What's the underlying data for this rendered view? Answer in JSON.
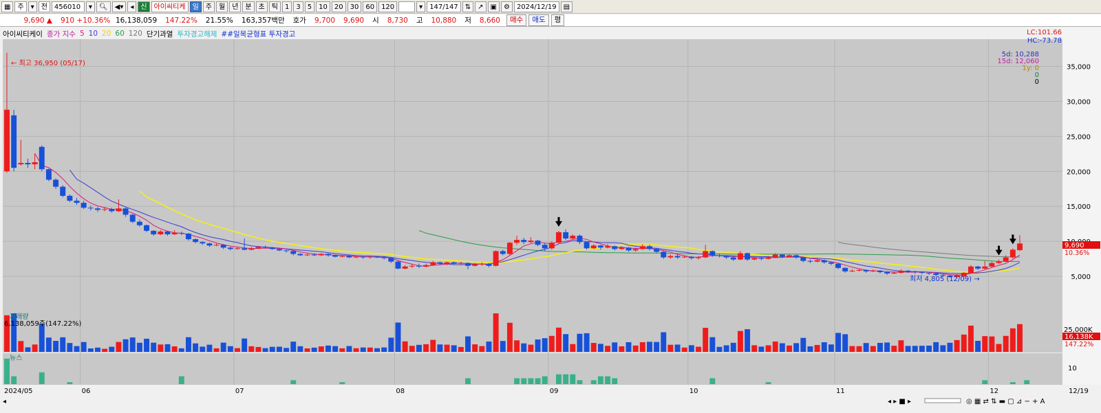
{
  "toolbar": {
    "code": "456010",
    "mode": "주",
    "market": "전",
    "badge": "신",
    "name": "아이씨티케",
    "periods": [
      "일",
      "주",
      "월",
      "년",
      "분",
      "초",
      "틱"
    ],
    "ticks": [
      "1",
      "3",
      "5",
      "10",
      "20",
      "30",
      "60",
      "120"
    ],
    "count": "147/147",
    "date": "2024/12/19"
  },
  "quote": {
    "price": "9,690",
    "change": "910",
    "change_pct": "+10.36%",
    "volume": "16,138,059",
    "vol_pct": "147.22%",
    "turnover": "21.55%",
    "amount": "163,357백만",
    "ask_label": "호가",
    "ask1": "9,700",
    "ask2": "9,690",
    "open_label": "시",
    "open": "8,730",
    "high_label": "고",
    "high": "10,880",
    "low_label": "저",
    "low": "8,660",
    "buy": "매수",
    "sell": "매도",
    "flat": "평"
  },
  "legend": {
    "name": "아이씨티케이",
    "ma_label": "종가 지수",
    "ma": [
      "5",
      "10",
      "20",
      "60",
      "120"
    ],
    "warn1": "단기과열",
    "warn2": "투자경고해제",
    "warn3": "##일목균형표 투자경고"
  },
  "colors": {
    "up": "#ee1c1c",
    "down": "#1850d8",
    "ma5": "#d81a7a",
    "ma10": "#3c3cd0",
    "ma20": "#f4ef1a",
    "ma60": "#2a9a48",
    "ma120": "#7a7a7a",
    "bg": "#c8c8c8"
  },
  "corner": {
    "lc": "LC:101.66",
    "hc": "HC:-73.78"
  },
  "right_info": {
    "d5": "5d: 10,288",
    "d15": "15d: 12,060",
    "y1": "1y: 0",
    "z1": "0",
    "z2": "0"
  },
  "chart_data": {
    "type": "candlestick",
    "y_ticks": [
      "35,000",
      "30,000",
      "25,000",
      "20,000",
      "15,000",
      "10,000",
      "5,000"
    ],
    "ylim": [
      0,
      38000
    ],
    "x_labels": [
      "2024/05",
      "06",
      "07",
      "08",
      "09",
      "10",
      "11",
      "12",
      "12/19"
    ],
    "annotations": {
      "high": "최고 36,950 (05/17)",
      "low": "최저 4,805 (12/09)"
    },
    "last_price": "9,690",
    "last_pct": "10.36%",
    "candles": [
      {
        "o": 20000,
        "c": 28800,
        "h": 36950,
        "l": 19800
      },
      {
        "o": 28000,
        "c": 20500,
        "h": 28800,
        "l": 20000
      },
      {
        "o": 21000,
        "c": 21200,
        "h": 24500,
        "l": 20800
      },
      {
        "o": 21200,
        "c": 21000,
        "h": 21800,
        "l": 20500
      },
      {
        "o": 21000,
        "c": 21300,
        "h": 22500,
        "l": 20300
      },
      {
        "o": 23500,
        "c": 20300,
        "h": 23700,
        "l": 20000
      },
      {
        "o": 20300,
        "c": 18800,
        "h": 20400,
        "l": 18600
      },
      {
        "o": 18800,
        "c": 17800,
        "h": 19000,
        "l": 17500
      },
      {
        "o": 17800,
        "c": 16500,
        "h": 18000,
        "l": 16300
      },
      {
        "o": 16500,
        "c": 15800,
        "h": 16700,
        "l": 15600
      },
      {
        "o": 15800,
        "c": 15500,
        "h": 16200,
        "l": 15200
      },
      {
        "o": 15500,
        "c": 14800,
        "h": 15800,
        "l": 14600
      },
      {
        "o": 14800,
        "c": 14700,
        "h": 15100,
        "l": 14400
      },
      {
        "o": 14700,
        "c": 14500,
        "h": 14900,
        "l": 14200
      },
      {
        "o": 14500,
        "c": 14600,
        "h": 14900,
        "l": 14300
      },
      {
        "o": 14600,
        "c": 14300,
        "h": 14800,
        "l": 14100
      },
      {
        "o": 14300,
        "c": 14700,
        "h": 16000,
        "l": 14200
      },
      {
        "o": 14700,
        "c": 13800,
        "h": 14800,
        "l": 13500
      },
      {
        "o": 13800,
        "c": 12800,
        "h": 13900,
        "l": 12600
      },
      {
        "o": 12800,
        "c": 12300,
        "h": 13100,
        "l": 12100
      },
      {
        "o": 12300,
        "c": 11500,
        "h": 12400,
        "l": 11300
      },
      {
        "o": 11500,
        "c": 11000,
        "h": 11600,
        "l": 10800
      },
      {
        "o": 11000,
        "c": 11400,
        "h": 11600,
        "l": 10900
      },
      {
        "o": 11400,
        "c": 11000,
        "h": 11500,
        "l": 10800
      },
      {
        "o": 11000,
        "c": 11200,
        "h": 11600,
        "l": 10900
      },
      {
        "o": 11200,
        "c": 11100,
        "h": 11400,
        "l": 10900
      },
      {
        "o": 11100,
        "c": 10300,
        "h": 11200,
        "l": 10100
      },
      {
        "o": 10300,
        "c": 9900,
        "h": 10400,
        "l": 9700
      },
      {
        "o": 9900,
        "c": 9700,
        "h": 10000,
        "l": 9500
      },
      {
        "o": 9700,
        "c": 9400,
        "h": 9800,
        "l": 9200
      },
      {
        "o": 9400,
        "c": 9500,
        "h": 9700,
        "l": 9300
      },
      {
        "o": 9500,
        "c": 9100,
        "h": 9600,
        "l": 8900
      },
      {
        "o": 9100,
        "c": 8900,
        "h": 9200,
        "l": 8700
      },
      {
        "o": 8900,
        "c": 9000,
        "h": 9200,
        "l": 8800
      },
      {
        "o": 9000,
        "c": 8800,
        "h": 10400,
        "l": 8700
      },
      {
        "o": 8800,
        "c": 9000,
        "h": 9200,
        "l": 8700
      },
      {
        "o": 9000,
        "c": 9200,
        "h": 9300,
        "l": 8900
      },
      {
        "o": 9200,
        "c": 9100,
        "h": 9400,
        "l": 9000
      },
      {
        "o": 9100,
        "c": 8900,
        "h": 9200,
        "l": 8800
      },
      {
        "o": 8900,
        "c": 8700,
        "h": 9000,
        "l": 8600
      },
      {
        "o": 8700,
        "c": 8600,
        "h": 8800,
        "l": 8400
      },
      {
        "o": 8600,
        "c": 8200,
        "h": 8700,
        "l": 8000
      },
      {
        "o": 8200,
        "c": 8000,
        "h": 8300,
        "l": 7900
      },
      {
        "o": 8000,
        "c": 8100,
        "h": 8200,
        "l": 7900
      },
      {
        "o": 8100,
        "c": 8000,
        "h": 8300,
        "l": 7900
      },
      {
        "o": 8000,
        "c": 8200,
        "h": 8300,
        "l": 7900
      },
      {
        "o": 8200,
        "c": 8000,
        "h": 8300,
        "l": 7800
      },
      {
        "o": 8000,
        "c": 7800,
        "h": 8100,
        "l": 7700
      },
      {
        "o": 7800,
        "c": 7900,
        "h": 8000,
        "l": 7700
      },
      {
        "o": 7900,
        "c": 7700,
        "h": 8000,
        "l": 7600
      },
      {
        "o": 7700,
        "c": 7800,
        "h": 7900,
        "l": 7600
      },
      {
        "o": 7800,
        "c": 7700,
        "h": 7900,
        "l": 7500
      },
      {
        "o": 7700,
        "c": 7800,
        "h": 7900,
        "l": 7500
      },
      {
        "o": 7800,
        "c": 7700,
        "h": 7900,
        "l": 7600
      },
      {
        "o": 7700,
        "c": 7600,
        "h": 7800,
        "l": 7400
      },
      {
        "o": 7600,
        "c": 7100,
        "h": 7700,
        "l": 6900
      },
      {
        "o": 7100,
        "c": 6100,
        "h": 7200,
        "l": 6000
      },
      {
        "o": 6100,
        "c": 6400,
        "h": 6600,
        "l": 6000
      },
      {
        "o": 6400,
        "c": 6500,
        "h": 6700,
        "l": 6200
      },
      {
        "o": 6500,
        "c": 6400,
        "h": 6800,
        "l": 6200
      },
      {
        "o": 6400,
        "c": 6600,
        "h": 6800,
        "l": 6300
      },
      {
        "o": 6600,
        "c": 7000,
        "h": 7200,
        "l": 6500
      },
      {
        "o": 7000,
        "c": 6800,
        "h": 7100,
        "l": 6600
      },
      {
        "o": 6800,
        "c": 7000,
        "h": 7100,
        "l": 6600
      },
      {
        "o": 7000,
        "c": 6800,
        "h": 7100,
        "l": 6700
      },
      {
        "o": 6800,
        "c": 6900,
        "h": 7100,
        "l": 6700
      },
      {
        "o": 6900,
        "c": 6500,
        "h": 7000,
        "l": 6000
      },
      {
        "o": 6500,
        "c": 6700,
        "h": 6900,
        "l": 6400
      },
      {
        "o": 6700,
        "c": 6800,
        "h": 7000,
        "l": 6500
      },
      {
        "o": 6800,
        "c": 6500,
        "h": 6900,
        "l": 6300
      },
      {
        "o": 6500,
        "c": 8600,
        "h": 8700,
        "l": 6400
      },
      {
        "o": 8600,
        "c": 8200,
        "h": 8800,
        "l": 8000
      },
      {
        "o": 8200,
        "c": 9800,
        "h": 9900,
        "l": 8000
      },
      {
        "o": 9800,
        "c": 10200,
        "h": 10800,
        "l": 9500
      },
      {
        "o": 10200,
        "c": 9900,
        "h": 10500,
        "l": 9600
      },
      {
        "o": 9900,
        "c": 10100,
        "h": 10600,
        "l": 9700
      },
      {
        "o": 10100,
        "c": 9500,
        "h": 10200,
        "l": 9300
      },
      {
        "o": 9500,
        "c": 9000,
        "h": 9800,
        "l": 8600
      },
      {
        "o": 9000,
        "c": 9800,
        "h": 10000,
        "l": 8800
      },
      {
        "o": 9800,
        "c": 11300,
        "h": 11500,
        "l": 9600
      },
      {
        "o": 11300,
        "c": 10400,
        "h": 11700,
        "l": 10200
      },
      {
        "o": 10400,
        "c": 10800,
        "h": 11000,
        "l": 10300
      },
      {
        "o": 10800,
        "c": 9900,
        "h": 11000,
        "l": 9600
      },
      {
        "o": 9900,
        "c": 9000,
        "h": 10000,
        "l": 8800
      },
      {
        "o": 9000,
        "c": 9400,
        "h": 9600,
        "l": 8900
      },
      {
        "o": 9400,
        "c": 9100,
        "h": 9500,
        "l": 8800
      },
      {
        "o": 9100,
        "c": 9300,
        "h": 9600,
        "l": 9000
      },
      {
        "o": 9300,
        "c": 8900,
        "h": 9400,
        "l": 8700
      },
      {
        "o": 8900,
        "c": 9100,
        "h": 9300,
        "l": 8800
      },
      {
        "o": 9100,
        "c": 8700,
        "h": 9200,
        "l": 8500
      },
      {
        "o": 8700,
        "c": 8900,
        "h": 9100,
        "l": 8500
      },
      {
        "o": 8900,
        "c": 9300,
        "h": 9600,
        "l": 8800
      },
      {
        "o": 9300,
        "c": 8900,
        "h": 9500,
        "l": 8700
      },
      {
        "o": 8900,
        "c": 8500,
        "h": 9000,
        "l": 8300
      },
      {
        "o": 8500,
        "c": 7700,
        "h": 8600,
        "l": 7500
      },
      {
        "o": 7700,
        "c": 7900,
        "h": 8100,
        "l": 7500
      },
      {
        "o": 7900,
        "c": 7700,
        "h": 8100,
        "l": 7500
      },
      {
        "o": 7700,
        "c": 7800,
        "h": 8000,
        "l": 7600
      },
      {
        "o": 7800,
        "c": 7600,
        "h": 7900,
        "l": 7400
      },
      {
        "o": 7600,
        "c": 7700,
        "h": 7900,
        "l": 7400
      },
      {
        "o": 7700,
        "c": 8600,
        "h": 9500,
        "l": 7600
      },
      {
        "o": 8600,
        "c": 8000,
        "h": 8700,
        "l": 7800
      },
      {
        "o": 8000,
        "c": 7900,
        "h": 8200,
        "l": 7700
      },
      {
        "o": 7900,
        "c": 7700,
        "h": 8000,
        "l": 7500
      },
      {
        "o": 7700,
        "c": 7400,
        "h": 7800,
        "l": 7200
      },
      {
        "o": 7400,
        "c": 8300,
        "h": 8600,
        "l": 7300
      },
      {
        "o": 8300,
        "c": 7400,
        "h": 8400,
        "l": 7200
      },
      {
        "o": 7400,
        "c": 7600,
        "h": 7800,
        "l": 7300
      },
      {
        "o": 7600,
        "c": 7500,
        "h": 7800,
        "l": 7300
      },
      {
        "o": 7500,
        "c": 7700,
        "h": 7900,
        "l": 7400
      },
      {
        "o": 7700,
        "c": 8100,
        "h": 8300,
        "l": 7600
      },
      {
        "o": 8100,
        "c": 7800,
        "h": 8200,
        "l": 7600
      },
      {
        "o": 7800,
        "c": 8000,
        "h": 8200,
        "l": 7700
      },
      {
        "o": 8000,
        "c": 7700,
        "h": 8100,
        "l": 7500
      },
      {
        "o": 7700,
        "c": 7200,
        "h": 7800,
        "l": 7000
      },
      {
        "o": 7200,
        "c": 7100,
        "h": 7400,
        "l": 6900
      },
      {
        "o": 7100,
        "c": 7300,
        "h": 7500,
        "l": 7000
      },
      {
        "o": 7300,
        "c": 7000,
        "h": 7400,
        "l": 6800
      },
      {
        "o": 7000,
        "c": 6800,
        "h": 7100,
        "l": 6600
      },
      {
        "o": 6800,
        "c": 6200,
        "h": 6900,
        "l": 6000
      },
      {
        "o": 6200,
        "c": 5700,
        "h": 6300,
        "l": 5500
      },
      {
        "o": 5700,
        "c": 5800,
        "h": 6000,
        "l": 5600
      },
      {
        "o": 5800,
        "c": 5900,
        "h": 6100,
        "l": 5700
      },
      {
        "o": 5900,
        "c": 5700,
        "h": 6000,
        "l": 5500
      },
      {
        "o": 5700,
        "c": 5800,
        "h": 6000,
        "l": 5600
      },
      {
        "o": 5800,
        "c": 5600,
        "h": 5900,
        "l": 5400
      },
      {
        "o": 5600,
        "c": 5400,
        "h": 5700,
        "l": 5200
      },
      {
        "o": 5400,
        "c": 5500,
        "h": 5700,
        "l": 5300
      },
      {
        "o": 5500,
        "c": 5800,
        "h": 6000,
        "l": 5400
      },
      {
        "o": 5800,
        "c": 5700,
        "h": 5900,
        "l": 5500
      },
      {
        "o": 5700,
        "c": 5600,
        "h": 5800,
        "l": 5400
      },
      {
        "o": 5600,
        "c": 5500,
        "h": 5700,
        "l": 5300
      },
      {
        "o": 5500,
        "c": 5400,
        "h": 5600,
        "l": 5200
      },
      {
        "o": 5400,
        "c": 5200,
        "h": 5500,
        "l": 5000
      },
      {
        "o": 5200,
        "c": 5100,
        "h": 5300,
        "l": 4900
      },
      {
        "o": 5100,
        "c": 4900,
        "h": 5200,
        "l": 4805
      },
      {
        "o": 4900,
        "c": 5200,
        "h": 5300,
        "l": 4805
      },
      {
        "o": 5000,
        "c": 5500,
        "h": 5600,
        "l": 4900
      },
      {
        "o": 5500,
        "c": 6400,
        "h": 6600,
        "l": 5400
      },
      {
        "o": 6400,
        "c": 6100,
        "h": 6500,
        "l": 5900
      },
      {
        "o": 6100,
        "c": 6400,
        "h": 7200,
        "l": 6000
      },
      {
        "o": 6400,
        "c": 6900,
        "h": 7100,
        "l": 6200
      },
      {
        "o": 6900,
        "c": 7100,
        "h": 7400,
        "l": 6800
      },
      {
        "o": 7100,
        "c": 7700,
        "h": 8000,
        "l": 7000
      },
      {
        "o": 7700,
        "c": 8800,
        "h": 9000,
        "l": 7500
      },
      {
        "o": 8730,
        "c": 9690,
        "h": 10880,
        "l": 8660
      }
    ],
    "ma5_start": 3,
    "ma10_start": 9,
    "ma20_start": 19,
    "ma60_start": 59,
    "ma120_start": 119,
    "volume_label": "거래량",
    "volume_value": "6,138,059주(147.22%)",
    "volume_tick": "25,000K",
    "volume_last": "16,138K",
    "volume_last_pct": "147.22%",
    "volume_max": 31000,
    "news_label": "뉴스",
    "news_tick": "10",
    "news_max": 14,
    "signal_arrows": [
      79,
      142,
      144
    ]
  }
}
